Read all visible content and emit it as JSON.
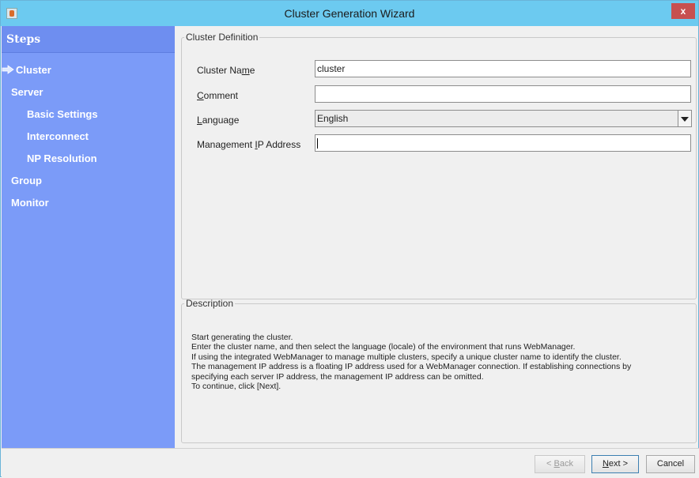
{
  "window": {
    "title": "Cluster Generation Wizard",
    "close_glyph": "x"
  },
  "steps": {
    "title": "Steps",
    "items": [
      {
        "label": "Cluster",
        "active": true
      },
      {
        "label": "Server"
      },
      {
        "label": "Basic Settings"
      },
      {
        "label": "Interconnect"
      },
      {
        "label": "NP Resolution"
      },
      {
        "label": "Group"
      },
      {
        "label": "Monitor"
      }
    ]
  },
  "definition": {
    "legend": "Cluster Definition",
    "cluster_name": {
      "label_pre": "Cluster Na",
      "label_mn": "m",
      "label_post": "e",
      "value": "cluster"
    },
    "comment": {
      "label_mn": "C",
      "label_post": "omment",
      "value": ""
    },
    "language": {
      "label_mn": "L",
      "label_post": "anguage",
      "value": "English"
    },
    "mgmt_ip": {
      "label_pre": "Management ",
      "label_mn": "I",
      "label_post": "P Address",
      "value": ""
    }
  },
  "description": {
    "legend": "Description",
    "lines": [
      "Start generating the cluster.",
      "Enter the cluster name, and then select the language (locale) of the environment that runs WebManager.",
      "If using the integrated WebManager to manage multiple clusters, specify a unique cluster name to identify the cluster.",
      "The management IP address is a floating IP address used for a WebManager connection. If establishing connections by",
      "specifying each server IP address, the management IP address can be omitted.",
      "To continue, click [Next]."
    ]
  },
  "buttons": {
    "back": {
      "pre": "< ",
      "mn": "B",
      "post": "ack"
    },
    "next": {
      "mn": "N",
      "post": "ext >"
    },
    "cancel": "Cancel"
  },
  "colors": {
    "titlebar": "#6ccaf0",
    "steps_panel": "#7b9bf8",
    "close": "#c75050"
  }
}
